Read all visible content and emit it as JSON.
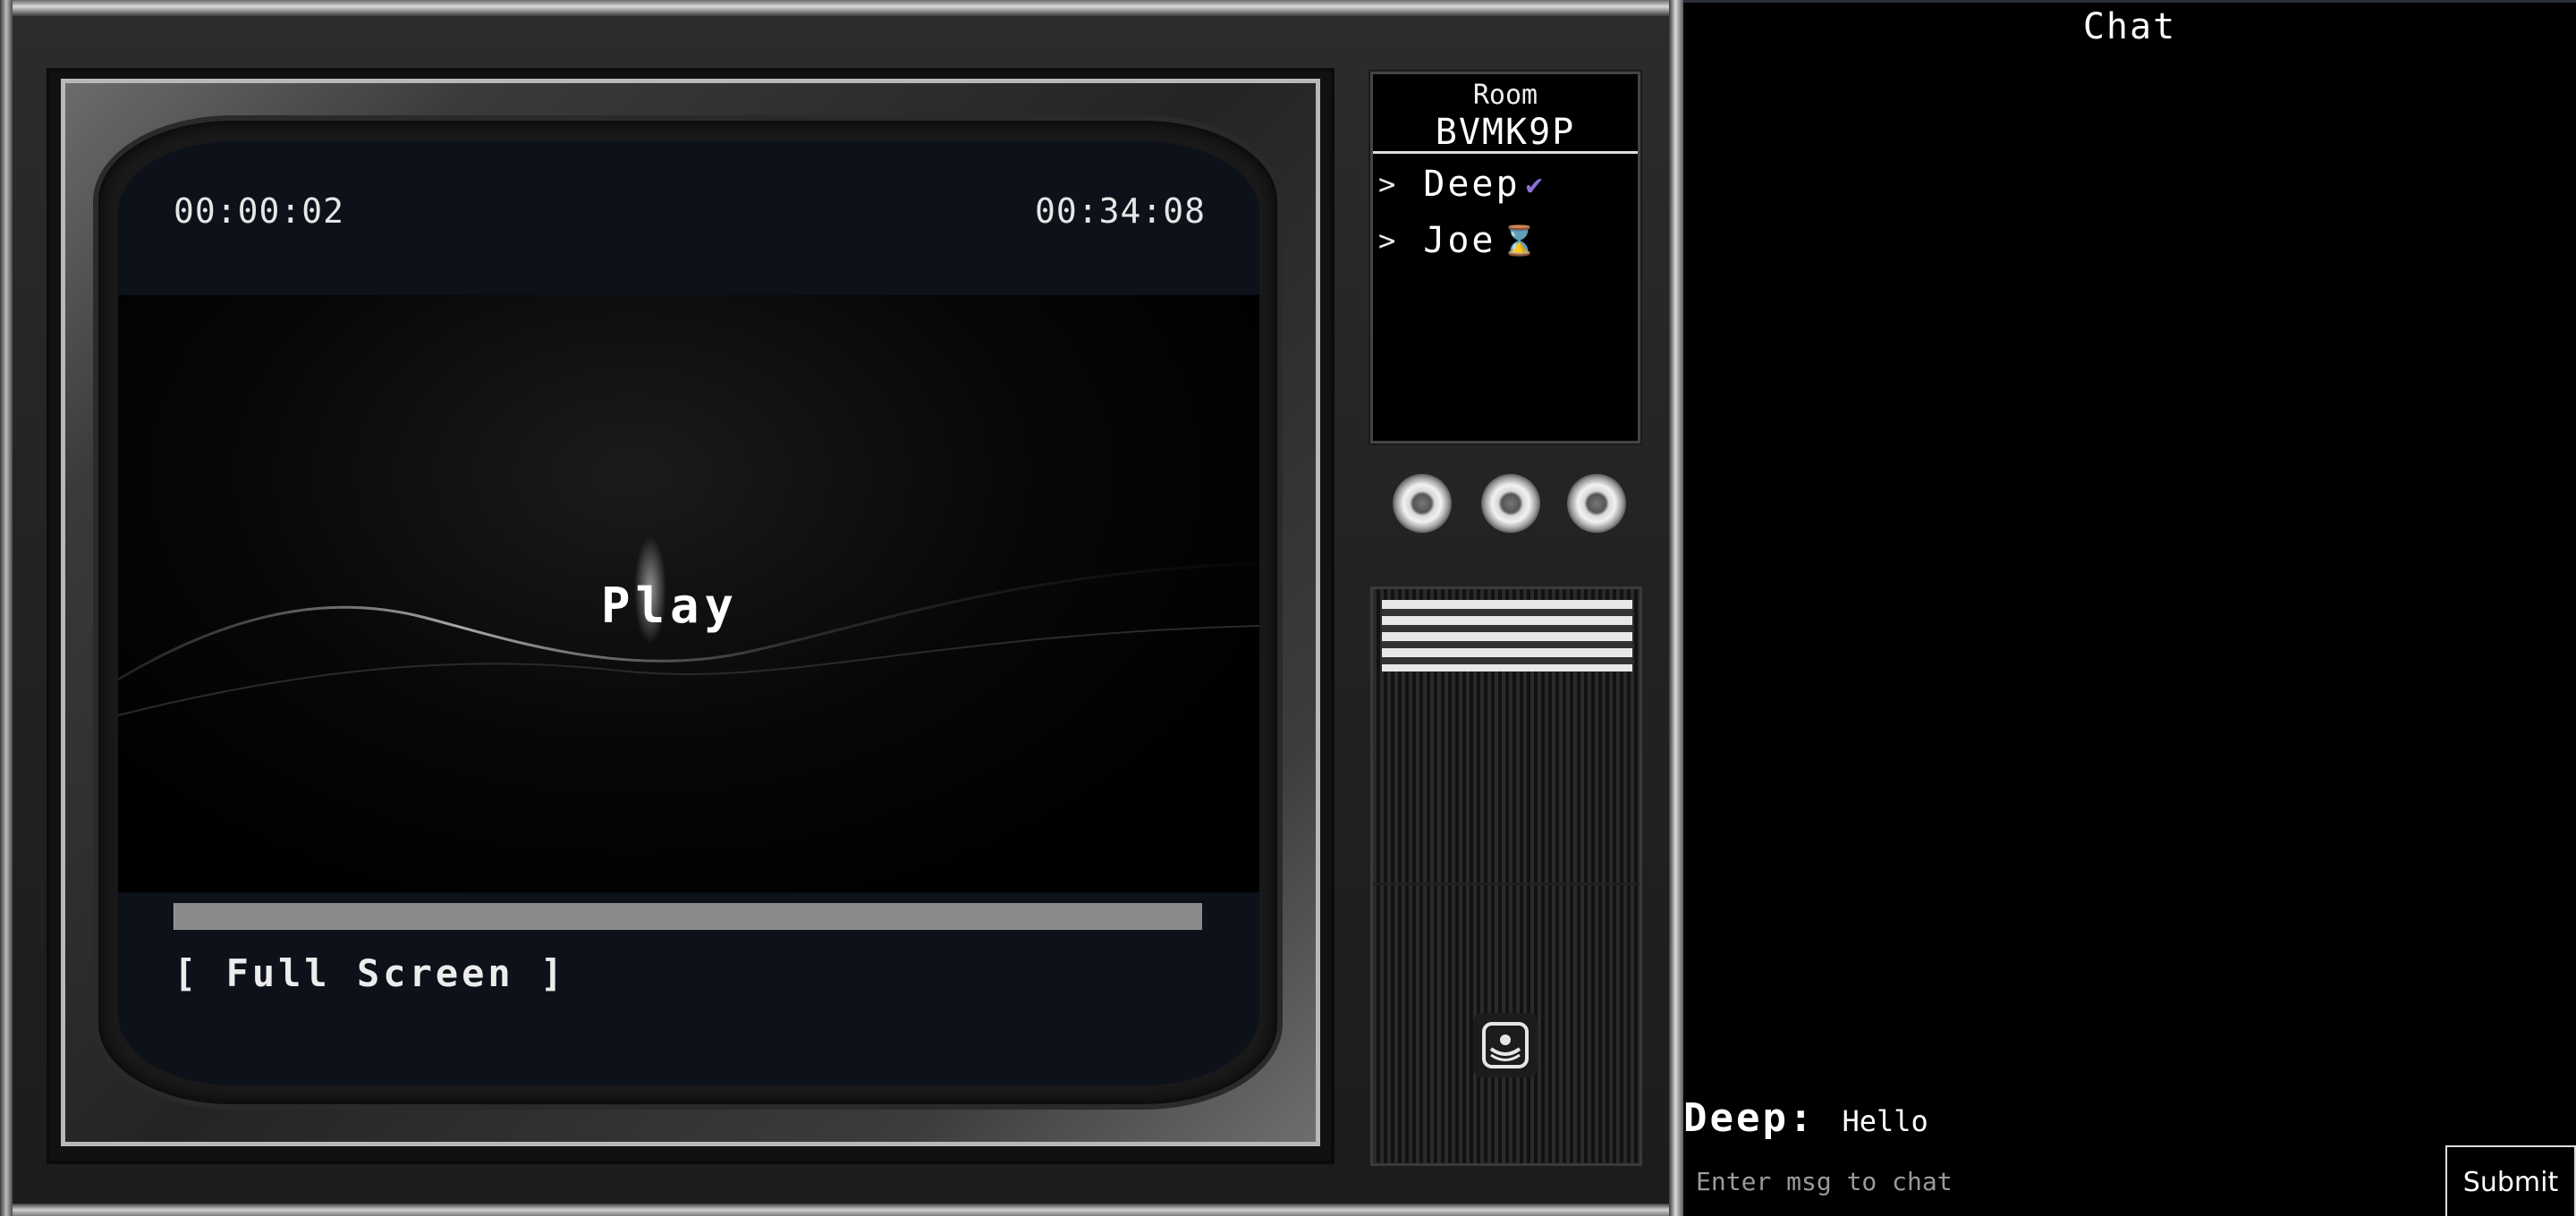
{
  "player": {
    "current_time": "00:00:02",
    "duration": "00:34:08",
    "play_label": "Play",
    "fullscreen_label": "[ Full Screen ]",
    "progress_fraction": 0.001
  },
  "room": {
    "label": "Room",
    "code": "BVMK9P",
    "members": [
      {
        "chevron": ">",
        "name": "Deep",
        "status_icon": "check-icon",
        "status_glyph": "✔",
        "status_color": "#8b6fd8"
      },
      {
        "chevron": ">",
        "name": "Joe",
        "status_icon": "hourglass-icon",
        "status_glyph": "⌛",
        "status_color": "#e0a33a"
      }
    ]
  },
  "chat": {
    "title": "Chat",
    "messages": [
      {
        "user": "Deep:",
        "text": "Hello"
      }
    ],
    "input_placeholder": "Enter msg to chat",
    "submit_label": "Submit"
  },
  "colors": {
    "background": "#000000",
    "cabinet": "#262626",
    "screen_bar": "#0c111a",
    "progress_track": "#8a8a8a"
  }
}
